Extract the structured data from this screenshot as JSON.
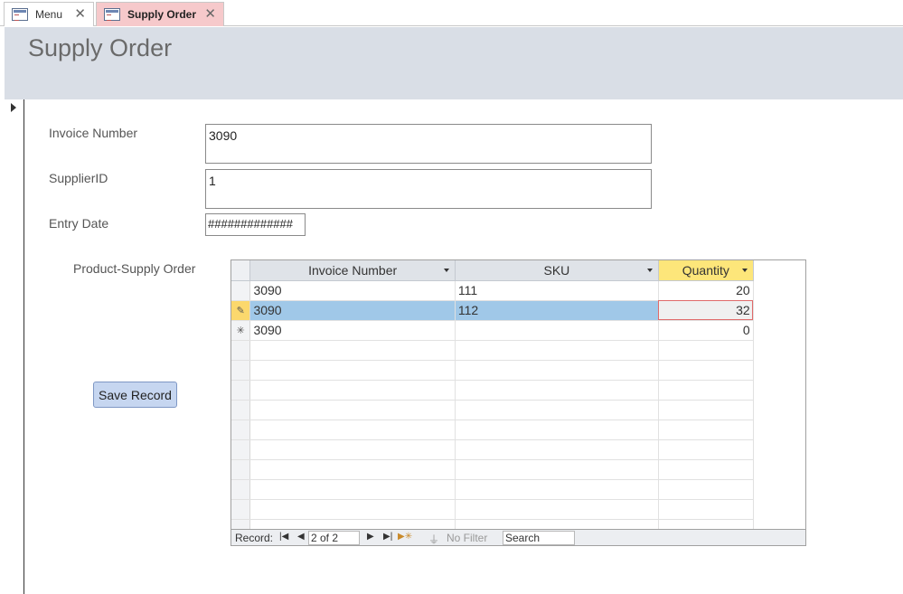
{
  "tabs": [
    {
      "label": "Menu",
      "active": false
    },
    {
      "label": "Supply Order",
      "active": true
    }
  ],
  "form": {
    "title": "Supply Order",
    "fields": {
      "invoice_number": {
        "label": "Invoice Number",
        "value": "3090"
      },
      "supplier_id": {
        "label": "SupplierID",
        "value": "1"
      },
      "entry_date": {
        "label": "Entry Date",
        "value": "#############"
      }
    },
    "subform_label": "Product-Supply Order",
    "save_button": "Save Record"
  },
  "datasheet": {
    "columns": [
      "Invoice Number",
      "SKU",
      "Quantity"
    ],
    "rows": [
      {
        "invoice": "3090",
        "sku": "111",
        "qty": "20",
        "state": ""
      },
      {
        "invoice": "3090",
        "sku": "112",
        "qty": "32",
        "state": "editing"
      },
      {
        "invoice": "3090",
        "sku": "",
        "qty": "0",
        "state": "new"
      }
    ]
  },
  "navigation": {
    "record_label": "Record:",
    "record_position": "2 of 2",
    "filter_label": "No Filter",
    "search_placeholder": "Search"
  },
  "colors": {
    "active_tab": "#f6c9cb",
    "header_band": "#d9dee6",
    "selected_row": "#a0c8e8",
    "sorted_column_header": "#fde67a",
    "save_button": "#c6d6f0"
  }
}
